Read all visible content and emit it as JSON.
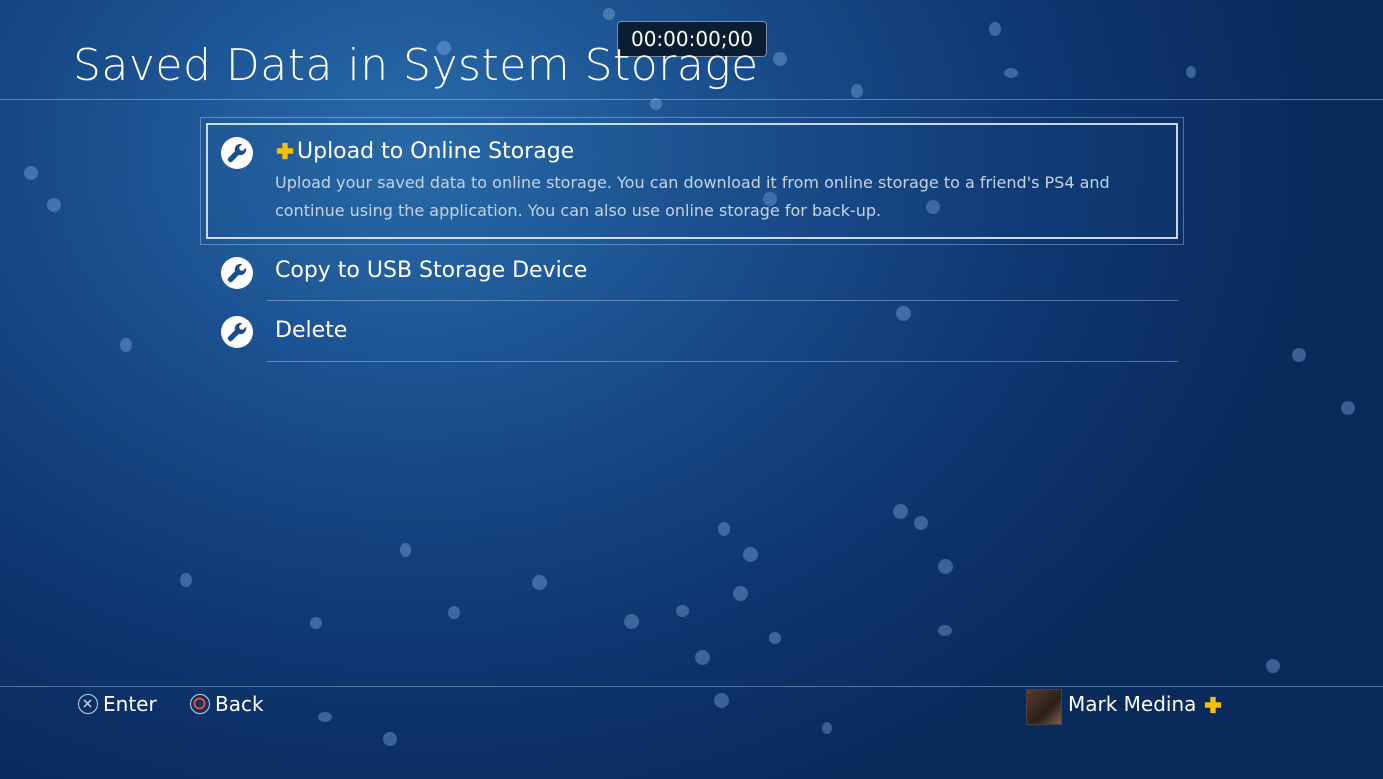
{
  "header": {
    "title": "Saved Data in System Storage",
    "timer": "00:00:00;00"
  },
  "menu": {
    "items": [
      {
        "label": "Upload to Online Storage",
        "description": "Upload your saved data to online storage. You can download it from online storage to a friend's PS4 and continue using the application. You can also use online storage for back-up.",
        "icon": "wrench-icon",
        "badge": "ps-plus-icon",
        "selected": true
      },
      {
        "label": "Copy to USB Storage Device",
        "icon": "wrench-icon",
        "selected": false
      },
      {
        "label": "Delete",
        "icon": "wrench-icon",
        "selected": false
      }
    ]
  },
  "footer": {
    "enter_label": "Enter",
    "back_label": "Back",
    "user_name": "Mark Medina",
    "user_badge": "ps-plus-icon"
  },
  "colors": {
    "background": "#1a4f8e",
    "plus_gold": "#f5c000",
    "circle_button": "#e4512a"
  }
}
